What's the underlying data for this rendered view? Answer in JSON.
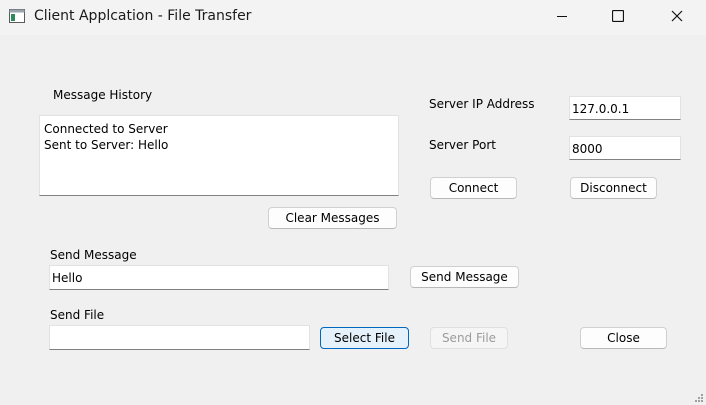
{
  "window": {
    "title": "Client Applcation - File Transfer"
  },
  "history": {
    "label": "Message History",
    "lines": [
      "Connected to Server",
      "Sent to Server: Hello"
    ],
    "clear_label": "Clear Messages"
  },
  "server": {
    "ip_label": "Server IP Address",
    "ip_value": "127.0.0.1",
    "port_label": "Server Port",
    "port_value": "8000",
    "connect_label": "Connect",
    "disconnect_label": "Disconnect"
  },
  "message": {
    "label": "Send Message",
    "value": "Hello",
    "send_label": "Send Message"
  },
  "file": {
    "label": "Send File",
    "value": "",
    "select_label": "Select File",
    "send_label": "Send File",
    "close_label": "Close"
  }
}
